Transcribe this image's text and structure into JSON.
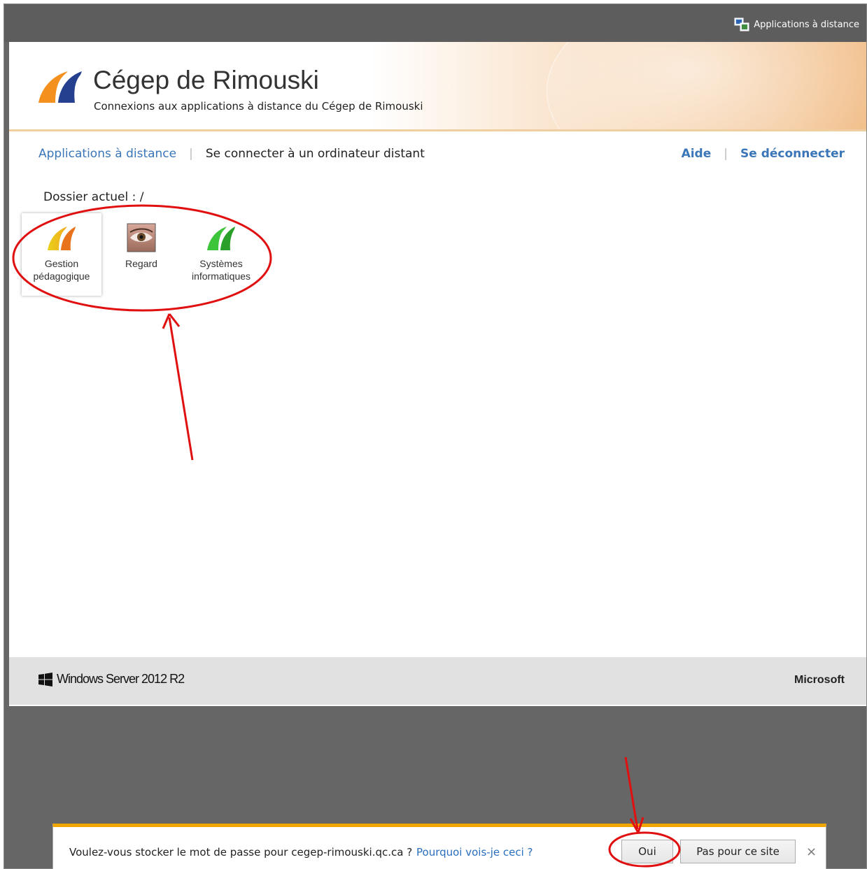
{
  "topbar": {
    "app_label": "Applications à distance"
  },
  "header": {
    "title": "Cégep de Rimouski",
    "subtitle": "Connexions aux applications à distance du Cégep de Rimouski"
  },
  "nav": {
    "remote_apps": "Applications à distance",
    "connect_remote": "Se connecter à un ordinateur distant",
    "help": "Aide",
    "logout": "Se déconnecter",
    "separator": "|"
  },
  "folder": {
    "label": "Dossier actuel : /"
  },
  "apps": [
    {
      "line1": "Gestion",
      "line2": "pédagogique",
      "icon": "orange-yellow-c-logo-icon"
    },
    {
      "line1": "Regard",
      "line2": "",
      "icon": "eye-icon"
    },
    {
      "line1": "Systèmes",
      "line2": "informatiques",
      "icon": "green-c-logo-icon"
    }
  ],
  "footer": {
    "product": "Windows Server 2012 R2",
    "vendor": "Microsoft"
  },
  "password_bar": {
    "message": "Voulez-vous stocker le mot de passe pour cegep-rimouski.qc.ca ?",
    "why_link": "Pourquoi vois-je ceci ?",
    "yes_button": "Oui",
    "no_button": "Pas pour ce site",
    "close": "×"
  },
  "colors": {
    "accent_blue": "#3b76b9",
    "annotation_red": "#e01010",
    "bar_orange": "#f0a500"
  }
}
